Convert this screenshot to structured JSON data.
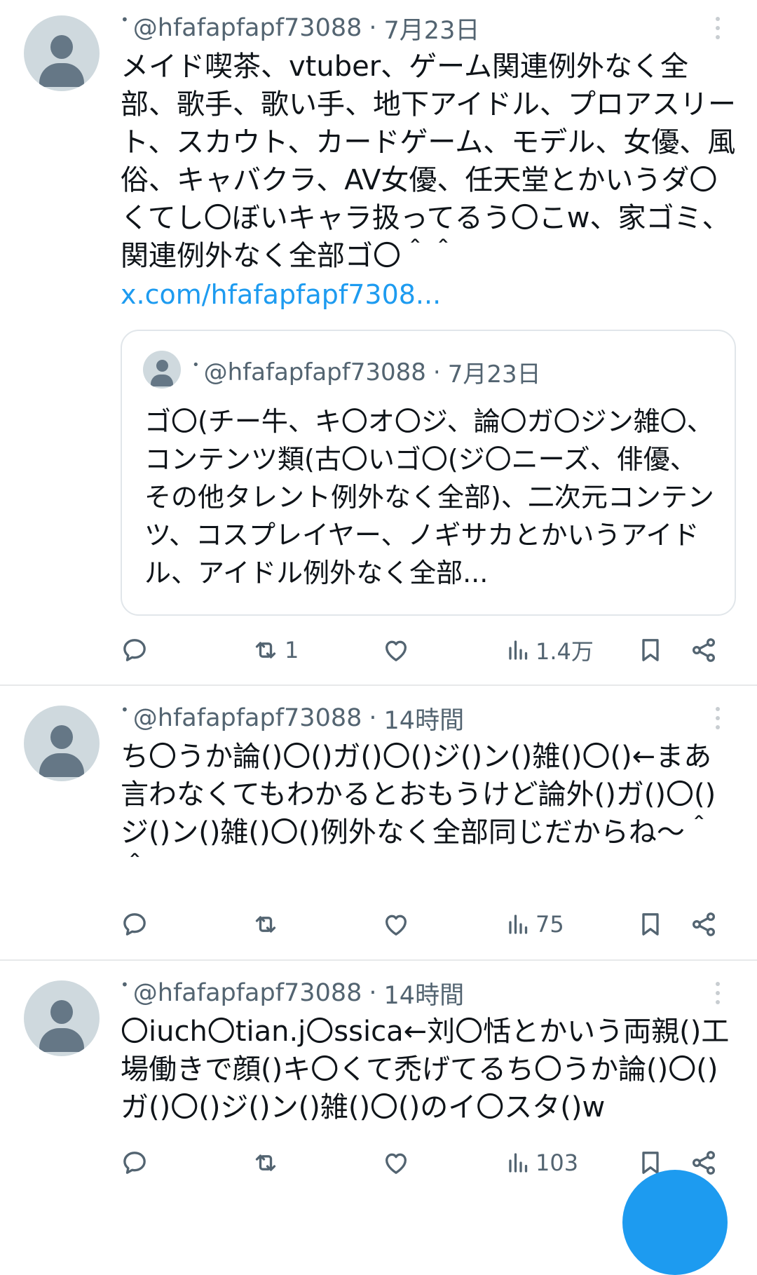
{
  "tweets": [
    {
      "handle": "@hfafapfapf73088",
      "time": "7月23日",
      "text": "メイド喫茶、vtuber、ゲーム関連例外なく全部、歌手、歌い手、地下アイドル、プロアスリート、スカウト、カードゲーム、モデル、女優、風俗、キャバクラ、AV女優、任天堂とかいうダ〇くてし〇ぼいキャラ扱ってるう〇こw、家ゴミ、関連例外なく全部ゴ〇＾＾",
      "link": "x.com/hfafapfapf7308...",
      "quote": {
        "handle": "@hfafapfapf73088",
        "time": "7月23日",
        "text": "ゴ〇(チー牛、キ〇オ〇ジ、論〇ガ〇ジン雑〇、コンテンツ類(古〇いゴ〇(ジ〇ニーズ、俳優、その他タレント例外なく全部)、二次元コンテンツ、コスプレイヤー、ノギサカとかいうアイドル、アイドル例外なく全部..."
      },
      "replies": "",
      "retweets": "1",
      "likes": "",
      "views": "1.4万"
    },
    {
      "handle": "@hfafapfapf73088",
      "time": "14時間",
      "text": "ち〇うか論()〇()ガ()〇()ジ()ン()雑()〇()←まあ言わなくてもわかるとおもうけど論外()ガ()〇()ジ()ン()雑()〇()例外なく全部同じだからね〜＾＾",
      "replies": "",
      "retweets": "",
      "likes": "",
      "views": "75"
    },
    {
      "handle": "@hfafapfapf73088",
      "time": "14時間",
      "text": "〇iuch〇tian.j〇ssica←刘〇恬とかいう両親()工場働きで顔()キ〇くて禿げてるち〇うか論()〇()ガ()〇()ジ()ン()雑()〇()のイ〇スタ()w",
      "replies": "",
      "retweets": "",
      "likes": "",
      "views": "103"
    }
  ],
  "separator": "·",
  "colors": {
    "text": "#0f1419",
    "muted": "#536471",
    "link": "#1d9bf0",
    "avatar_bg": "#cfd9de"
  },
  "icons": [
    "reply-icon",
    "retweet-icon",
    "like-icon",
    "views-icon",
    "bookmark-icon",
    "share-icon",
    "more-icon",
    "compose-fab"
  ]
}
